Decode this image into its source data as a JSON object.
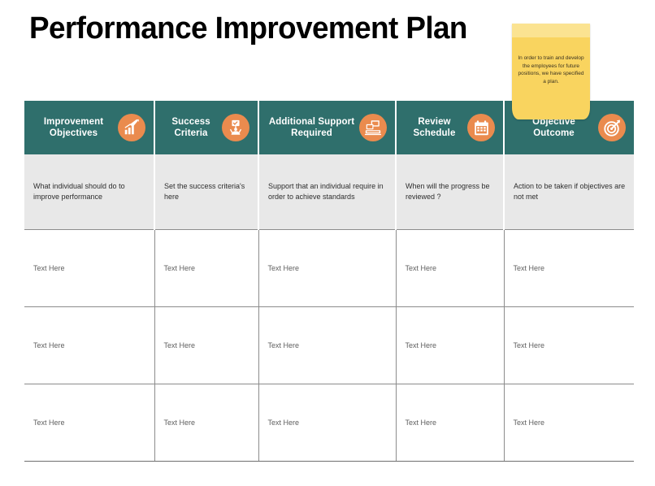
{
  "slide": {
    "title": "Performance Improvement Plan",
    "accent_teal": "#2f6f6c",
    "accent_orange": "#ea8b4e",
    "note_yellow": "#f9d45f",
    "desc_row_bg": "#e8e8e8"
  },
  "sticky_note": {
    "text": "In order to train and develop the employees for future positions, we have specified a plan."
  },
  "table": {
    "headers": [
      {
        "label": "Improvement Objectives",
        "icon": "growth-bar-chart-icon"
      },
      {
        "label": "Success Criteria",
        "icon": "person-checklist-icon"
      },
      {
        "label": "Additional  Support Required",
        "icon": "computer-monitor-icon"
      },
      {
        "label": "Review Schedule",
        "icon": "calendar-icon"
      },
      {
        "label": "Objective Outcome",
        "icon": "target-dart-icon"
      }
    ],
    "description_row": [
      "What individual should do to improve performance",
      "Set the success criteria's here",
      "Support that an individual require in order to achieve standards",
      "When will the progress be reviewed ?",
      "Action to be taken if objectives are not met"
    ],
    "data_rows": [
      [
        "Text Here",
        "Text Here",
        "Text Here",
        "Text Here",
        "Text Here"
      ],
      [
        "Text Here",
        "Text Here",
        "Text Here",
        "Text Here",
        "Text Here"
      ],
      [
        "Text Here",
        "Text Here",
        "Text Here",
        "Text Here",
        "Text Here"
      ]
    ]
  }
}
